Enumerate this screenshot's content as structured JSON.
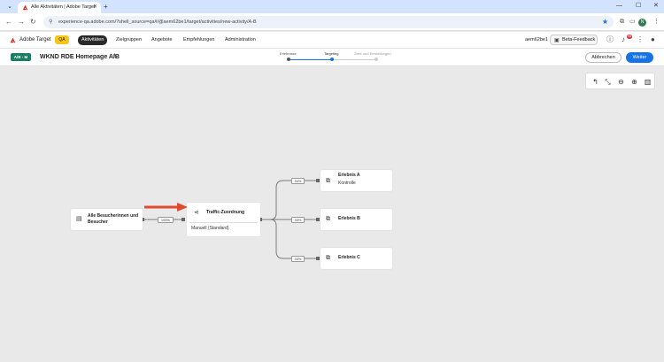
{
  "browser": {
    "tab_title": "Alle Aktivitäten | Adobe Target",
    "url": "experience-qa.adobe.com/?shell_source=qa#/@aem62be1/target/activities/new-activity/A-B",
    "profile_initial": "N"
  },
  "app": {
    "brand": "Adobe Target",
    "env_badge": "QA",
    "nav": [
      "Aktivitäten",
      "Zielgruppen",
      "Angebote",
      "Empfehlungen",
      "Administration"
    ],
    "active_nav": "Aktivitäten",
    "user": "aem62be1",
    "beta_feedback": "Beta-Feedback",
    "notification_count": "99"
  },
  "activity": {
    "type_badge": "A/B - M",
    "name": "WKND RDE Homepage A/B",
    "steps": [
      {
        "label": "Erlebnisse",
        "state": "done"
      },
      {
        "label": "Targeting",
        "state": "current"
      },
      {
        "label": "Ziele und Einstellungen",
        "state": "todo"
      }
    ],
    "cancel_label": "Abbrechen",
    "next_label": "Weiter"
  },
  "flow": {
    "audience_node": {
      "title": "Alle Besucherinnen und Besucher"
    },
    "audience_pct": "100%",
    "traffic_node": {
      "title": "Traffic-Zuordnung",
      "subtitle": "Manuell (Standard)"
    },
    "experiences": [
      {
        "pct": "34%",
        "title": "Erlebnis A",
        "subtitle": "Kontrolle"
      },
      {
        "pct": "33%",
        "title": "Erlebnis B",
        "subtitle": ""
      },
      {
        "pct": "33%",
        "title": "Erlebnis C",
        "subtitle": ""
      }
    ]
  },
  "colors": {
    "accent_blue": "#1473e6",
    "ab_badge": "#1b7e63",
    "env_badge": "#f5c518",
    "annotation_arrow": "#e04a2f"
  }
}
